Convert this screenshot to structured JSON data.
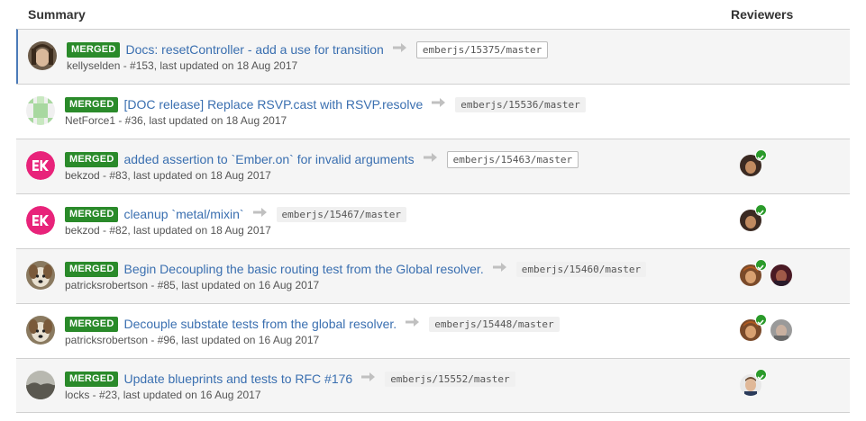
{
  "header": {
    "summary": "Summary",
    "reviewers": "Reviewers"
  },
  "colors": {
    "merged_badge": "#2a8a2a",
    "link": "#3a6fb0",
    "active_border": "#4a7ab8",
    "approved_check": "#2a9a2a"
  },
  "rows": [
    {
      "status": "MERGED",
      "title": "Docs: resetController - add a use for transition",
      "branch": "emberjs/15375/master",
      "meta": "kellyselden - #153, last updated on 18 Aug 2017",
      "avatar": "kellyselden-avatar",
      "reviewers": []
    },
    {
      "status": "MERGED",
      "title": "[DOC release] Replace RSVP.cast with RSVP.resolve",
      "branch": "emberjs/15536/master",
      "meta": "NetForce1 - #36, last updated on 18 Aug 2017",
      "avatar": "netforce1-identicon",
      "reviewers": []
    },
    {
      "status": "MERGED",
      "title": "added assertion to `Ember.on` for invalid arguments",
      "branch": "emberjs/15463/master",
      "meta": "bekzod - #83, last updated on 18 Aug 2017",
      "avatar": "bekzod-avatar",
      "reviewers": [
        {
          "approved": true
        }
      ]
    },
    {
      "status": "MERGED",
      "title": "cleanup `metal/mixin`",
      "branch": "emberjs/15467/master",
      "meta": "bekzod - #82, last updated on 18 Aug 2017",
      "avatar": "bekzod-avatar",
      "reviewers": [
        {
          "approved": true
        }
      ]
    },
    {
      "status": "MERGED",
      "title": "Begin Decoupling the basic routing test from the Global resolver.",
      "branch": "emberjs/15460/master",
      "meta": "patricksrobertson - #85, last updated on 16 Aug 2017",
      "avatar": "patricksrobertson-avatar",
      "reviewers": [
        {
          "approved": true
        },
        {
          "approved": false
        }
      ]
    },
    {
      "status": "MERGED",
      "title": "Decouple substate tests from the global resolver.",
      "branch": "emberjs/15448/master",
      "meta": "patricksrobertson - #96, last updated on 16 Aug 2017",
      "avatar": "patricksrobertson-avatar",
      "reviewers": [
        {
          "approved": true
        },
        {
          "approved": false
        }
      ]
    },
    {
      "status": "MERGED",
      "title": "Update blueprints and tests to RFC #176",
      "branch": "emberjs/15552/master",
      "meta": "locks - #23, last updated on 16 Aug 2017",
      "avatar": "locks-avatar",
      "reviewers": [
        {
          "approved": true
        }
      ]
    }
  ]
}
